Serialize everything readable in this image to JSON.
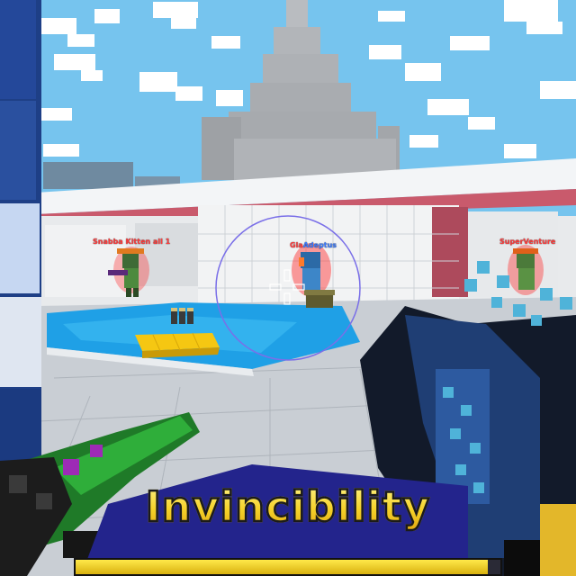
{
  "hud": {
    "powerup_label": "Invincibility",
    "powerup_level": 0.97,
    "powerup_color": "#f5d22a"
  },
  "players": {
    "left": {
      "name": "Snabba Kitten all 1",
      "color": "#ff3b3b"
    },
    "center_prefix": {
      "name": "Gla",
      "color": "#ff3b3b"
    },
    "center": {
      "name": "Adeptus",
      "color": "#3a7bff"
    },
    "right": {
      "name": "SuperVenture",
      "color": "#ff3b3b"
    }
  },
  "icons": {
    "crosshair": "crosshair-icon",
    "aim_circle": "aim-circle-icon"
  }
}
